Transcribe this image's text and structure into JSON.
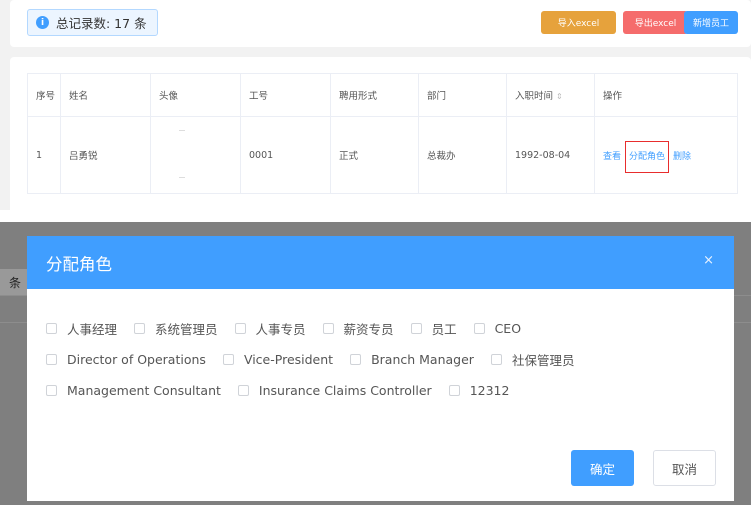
{
  "toolbar": {
    "count_label": "总记录数: 17 条",
    "import_label": "导入excel",
    "export_label": "导出excel",
    "add_label": "新增员工"
  },
  "table": {
    "headers": [
      "序号",
      "姓名",
      "头像",
      "工号",
      "聘用形式",
      "部门",
      "入职时间",
      "操作"
    ],
    "rows": [
      {
        "index": "1",
        "name": "吕勇锐",
        "emp_id": "0001",
        "hire_type": "正式",
        "dept": "总裁办",
        "join_date": "1992-08-04",
        "view": "查看",
        "assign": "分配角色",
        "delete": "删除"
      }
    ]
  },
  "background": {
    "partial_text": "条"
  },
  "dialog": {
    "title": "分配角色",
    "close": "×",
    "roles_rows": [
      [
        "人事经理",
        "系统管理员",
        "人事专员",
        "薪资专员",
        "员工",
        "CEO"
      ],
      [
        "Director of Operations",
        "Vice-President",
        "Branch Manager",
        "社保管理员"
      ],
      [
        "Management Consultant",
        "Insurance Claims Controller",
        "12312"
      ]
    ],
    "confirm": "确定",
    "cancel": "取消"
  },
  "colors": {
    "primary": "#409eff",
    "warning": "#e6a23c",
    "danger": "#f56c6c",
    "highlight": "#e82d2d"
  }
}
